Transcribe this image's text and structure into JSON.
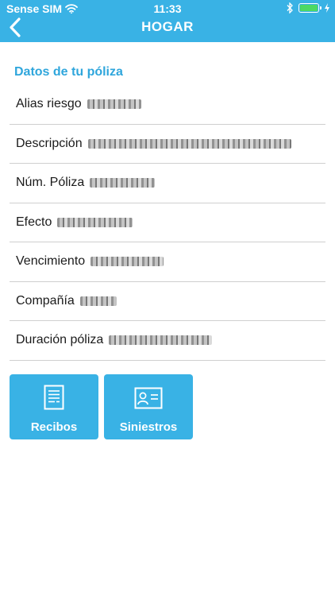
{
  "status_bar": {
    "carrier": "Sense SIM",
    "time": "11:33",
    "wifi_icon": "wifi-icon",
    "bluetooth_icon": "bluetooth-icon",
    "battery_icon": "battery-icon",
    "battery_level": 1.0
  },
  "nav": {
    "title": "HOGAR",
    "back_icon": "chevron-left-icon"
  },
  "policy": {
    "section_title": "Datos de tu póliza",
    "rows": [
      {
        "label": "Alias riesgo"
      },
      {
        "label": "Descripción"
      },
      {
        "label": "Núm. Póliza"
      },
      {
        "label": "Efecto"
      },
      {
        "label": "Vencimiento"
      },
      {
        "label": "Compañía"
      },
      {
        "label": "Duración póliza"
      }
    ]
  },
  "actions": [
    {
      "label": "Recibos",
      "icon": "document-icon"
    },
    {
      "label": "Siniestros",
      "icon": "id-card-icon"
    }
  ],
  "colors": {
    "primary": "#39b2e5",
    "section_title": "#2fa6dc",
    "divider": "#cfcfcf",
    "battery": "#4cd964"
  }
}
